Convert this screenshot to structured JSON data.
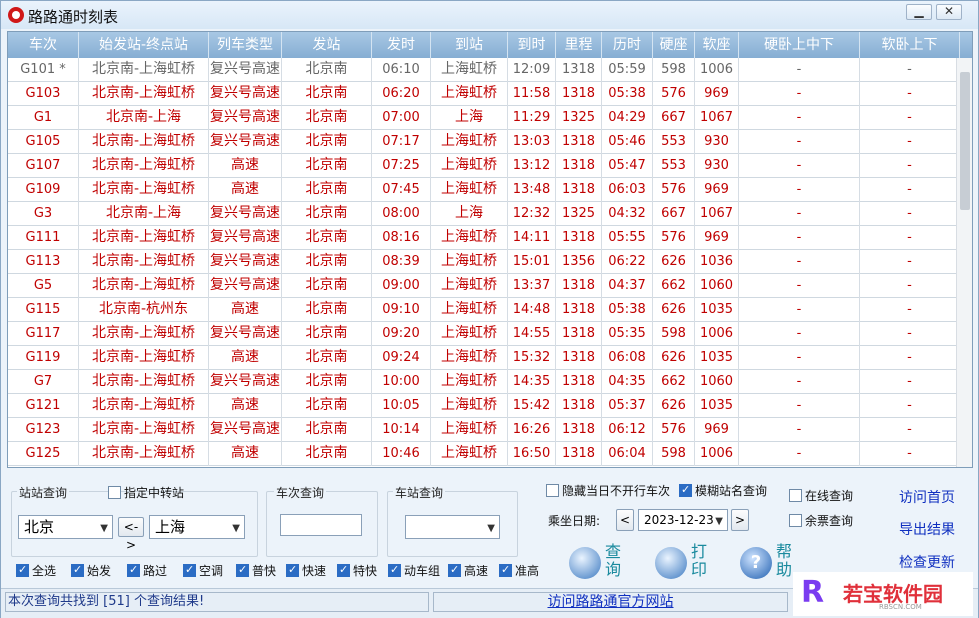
{
  "window": {
    "title": "路路通时刻表",
    "min_glyph": "▁",
    "close_glyph": "✕"
  },
  "table": {
    "columns": [
      "车次",
      "始发站-终点站",
      "列车类型",
      "发站",
      "发时",
      "到站",
      "到时",
      "里程",
      "历时",
      "硬座",
      "软座",
      "硬卧上中下",
      "软卧上下"
    ],
    "rows": [
      [
        "G101 *",
        "北京南-上海虹桥",
        "复兴号高速",
        "北京南",
        "06:10",
        "上海虹桥",
        "12:09",
        "1318",
        "05:59",
        "598",
        "1006",
        "-",
        "-"
      ],
      [
        "G103",
        "北京南-上海虹桥",
        "复兴号高速",
        "北京南",
        "06:20",
        "上海虹桥",
        "11:58",
        "1318",
        "05:38",
        "576",
        "969",
        "-",
        "-"
      ],
      [
        "G1",
        "北京南-上海",
        "复兴号高速",
        "北京南",
        "07:00",
        "上海",
        "11:29",
        "1325",
        "04:29",
        "667",
        "1067",
        "-",
        "-"
      ],
      [
        "G105",
        "北京南-上海虹桥",
        "复兴号高速",
        "北京南",
        "07:17",
        "上海虹桥",
        "13:03",
        "1318",
        "05:46",
        "553",
        "930",
        "-",
        "-"
      ],
      [
        "G107",
        "北京南-上海虹桥",
        "高速",
        "北京南",
        "07:25",
        "上海虹桥",
        "13:12",
        "1318",
        "05:47",
        "553",
        "930",
        "-",
        "-"
      ],
      [
        "G109",
        "北京南-上海虹桥",
        "高速",
        "北京南",
        "07:45",
        "上海虹桥",
        "13:48",
        "1318",
        "06:03",
        "576",
        "969",
        "-",
        "-"
      ],
      [
        "G3",
        "北京南-上海",
        "复兴号高速",
        "北京南",
        "08:00",
        "上海",
        "12:32",
        "1325",
        "04:32",
        "667",
        "1067",
        "-",
        "-"
      ],
      [
        "G111",
        "北京南-上海虹桥",
        "复兴号高速",
        "北京南",
        "08:16",
        "上海虹桥",
        "14:11",
        "1318",
        "05:55",
        "576",
        "969",
        "-",
        "-"
      ],
      [
        "G113",
        "北京南-上海虹桥",
        "复兴号高速",
        "北京南",
        "08:39",
        "上海虹桥",
        "15:01",
        "1356",
        "06:22",
        "626",
        "1036",
        "-",
        "-"
      ],
      [
        "G5",
        "北京南-上海虹桥",
        "复兴号高速",
        "北京南",
        "09:00",
        "上海虹桥",
        "13:37",
        "1318",
        "04:37",
        "662",
        "1060",
        "-",
        "-"
      ],
      [
        "G115",
        "北京南-杭州东",
        "高速",
        "北京南",
        "09:10",
        "上海虹桥",
        "14:48",
        "1318",
        "05:38",
        "626",
        "1035",
        "-",
        "-"
      ],
      [
        "G117",
        "北京南-上海虹桥",
        "复兴号高速",
        "北京南",
        "09:20",
        "上海虹桥",
        "14:55",
        "1318",
        "05:35",
        "598",
        "1006",
        "-",
        "-"
      ],
      [
        "G119",
        "北京南-上海虹桥",
        "高速",
        "北京南",
        "09:24",
        "上海虹桥",
        "15:32",
        "1318",
        "06:08",
        "626",
        "1035",
        "-",
        "-"
      ],
      [
        "G7",
        "北京南-上海虹桥",
        "复兴号高速",
        "北京南",
        "10:00",
        "上海虹桥",
        "14:35",
        "1318",
        "04:35",
        "662",
        "1060",
        "-",
        "-"
      ],
      [
        "G121",
        "北京南-上海虹桥",
        "高速",
        "北京南",
        "10:05",
        "上海虹桥",
        "15:42",
        "1318",
        "05:37",
        "626",
        "1035",
        "-",
        "-"
      ],
      [
        "G123",
        "北京南-上海虹桥",
        "复兴号高速",
        "北京南",
        "10:14",
        "上海虹桥",
        "16:26",
        "1318",
        "06:12",
        "576",
        "969",
        "-",
        "-"
      ],
      [
        "G125",
        "北京南-上海虹桥",
        "高速",
        "北京南",
        "10:46",
        "上海虹桥",
        "16:50",
        "1318",
        "06:04",
        "598",
        "1006",
        "-",
        "-"
      ]
    ]
  },
  "station_query": {
    "label": "站站查询",
    "transfer_label": "指定中转站",
    "from": "北京",
    "swap": "<->",
    "to": "上海"
  },
  "train_query": {
    "label": "车次查询",
    "value": ""
  },
  "station_lookup": {
    "label": "车站查询",
    "value": ""
  },
  "options": {
    "hide_not_running": "隐藏当日不开行车次",
    "fuzzy_station": "模糊站名查询",
    "online_query": "在线查询",
    "remaining_tickets": "余票查询",
    "date_label": "乘坐日期:",
    "date": "2023-12-23",
    "prev": "<",
    "next": ">"
  },
  "filters": [
    "全选",
    "始发",
    "路过",
    "空调",
    "普快",
    "快速",
    "特快",
    "动车组",
    "高速",
    "准高"
  ],
  "actions": {
    "query": "查询",
    "print": "打印",
    "help": "帮助"
  },
  "links": {
    "home": "访问首页",
    "export": "导出结果",
    "update": "检查更新"
  },
  "status": {
    "result": "本次查询共找到 [51] 个查询结果!",
    "site_link": "访问路路通官方网站"
  },
  "watermark": {
    "logo": "R",
    "text": "若宝软件园",
    "sub": "RBSCN.COM"
  },
  "colors": {
    "header": "#93b8db",
    "row_text": "#c00000",
    "link": "#1030c0",
    "accent": "#2b6cc4"
  }
}
